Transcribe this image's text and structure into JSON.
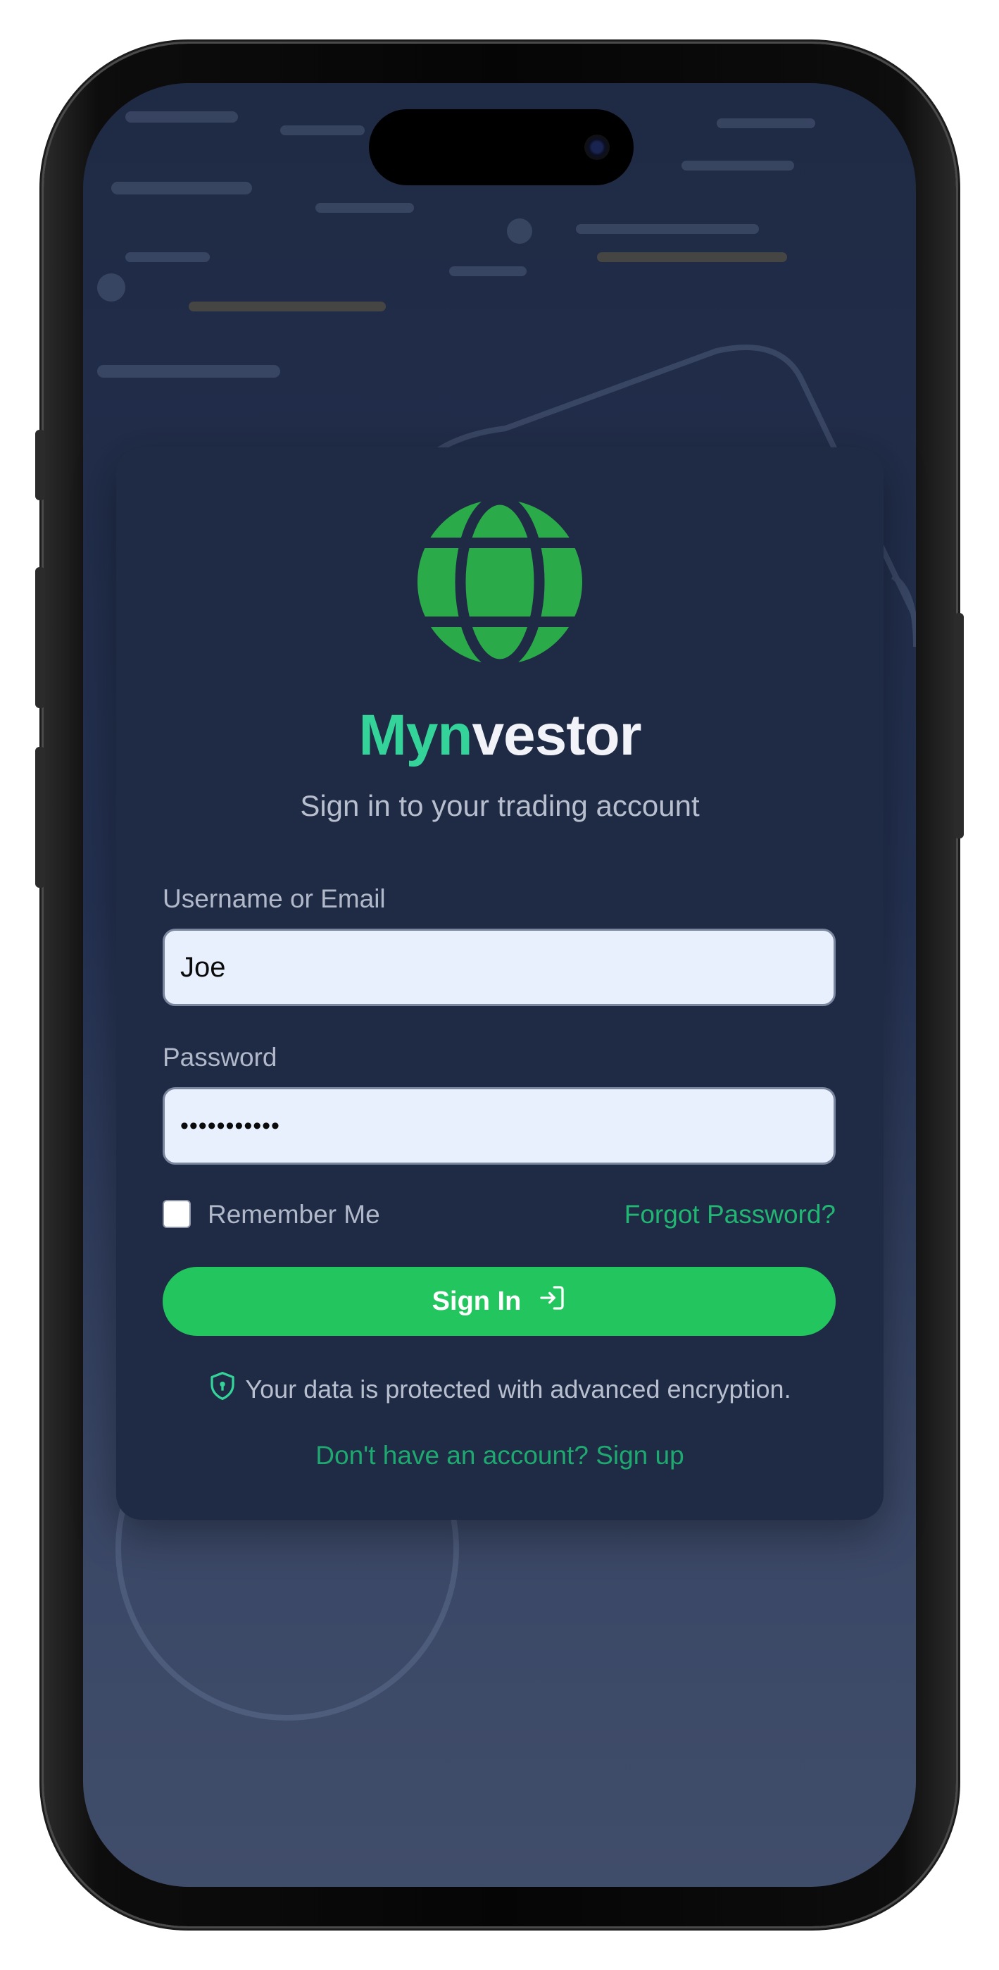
{
  "brand": {
    "name_part1": "Myn",
    "name_part2": "vestor",
    "subtitle": "Sign in to your trading account"
  },
  "form": {
    "username_label": "Username or Email",
    "username_value": "Joe",
    "password_label": "Password",
    "password_value": "•••••••••••",
    "remember_label": "Remember Me",
    "forgot_label": "Forgot Password?",
    "signin_label": "Sign In"
  },
  "footer": {
    "security_text": "Your data is protected with advanced encryption.",
    "signup_text": "Don't have an account? Sign up"
  },
  "colors": {
    "accent_green": "#22c55e",
    "brand_teal": "#34d399",
    "logo_green": "#2baa4a",
    "card_bg": "#1f2a44"
  },
  "icons": {
    "logo": "globe-icon",
    "signin": "sign-in-icon",
    "security": "shield-lock-icon"
  }
}
